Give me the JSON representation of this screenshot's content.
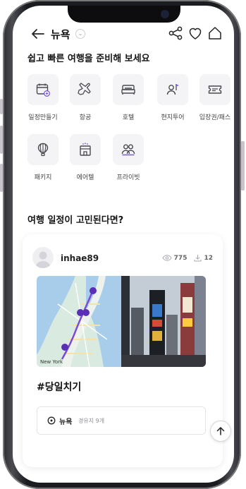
{
  "header": {
    "title": "뉴욕",
    "chevron": "⌄",
    "icons": [
      "back-arrow-icon",
      "share-icon",
      "heart-icon",
      "home-icon"
    ]
  },
  "prepare": {
    "title": "쉽고 빠른 여행을 준비해 보세요",
    "categories": [
      {
        "label": "일정만들기",
        "icon": "calendar-plus-icon"
      },
      {
        "label": "항공",
        "icon": "airplane-icon"
      },
      {
        "label": "호텔",
        "icon": "bed-icon"
      },
      {
        "label": "현지투어",
        "icon": "tour-guide-icon"
      },
      {
        "label": "입장권/패스",
        "icon": "ticket-icon"
      },
      {
        "label": "패키지",
        "icon": "hot-air-balloon-icon"
      },
      {
        "label": "에어텔",
        "icon": "airtel-icon"
      },
      {
        "label": "프라이빗",
        "icon": "private-group-icon"
      }
    ]
  },
  "itinerary": {
    "title": "여행 일정이 고민된다면?",
    "card": {
      "username": "inhae89",
      "views": "775",
      "downloads": "12",
      "map_label": "New York",
      "hashtag": "#당일치기",
      "city": "뉴욕",
      "waypoints": "경유지 9개"
    }
  },
  "top_button": {
    "icon": "arrow-up-icon"
  }
}
